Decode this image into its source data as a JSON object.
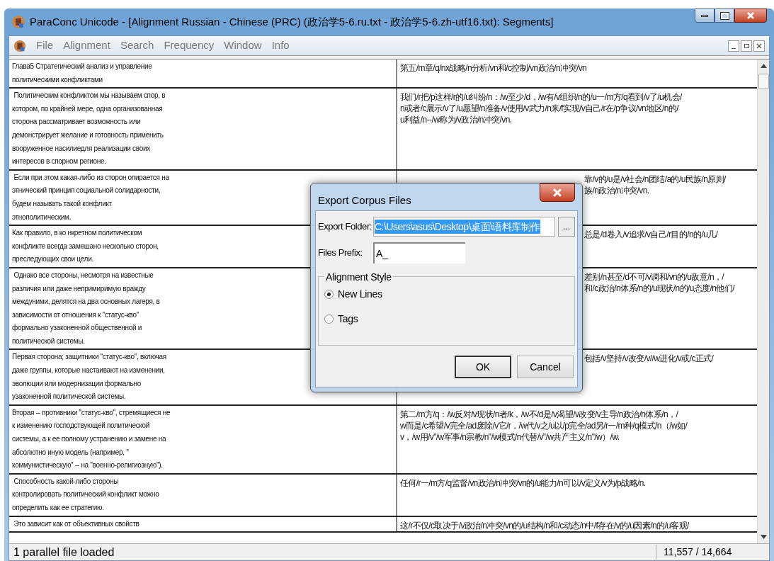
{
  "window": {
    "title": "ParaConc Unicode - [Alignment Russian - Chinese (PRC) (政治学5-6.ru.txt - 政治学5-6.zh-utf16.txt): Segments]"
  },
  "menu": [
    "File",
    "Alignment",
    "Search",
    "Frequency",
    "Window",
    "Info"
  ],
  "segments": [
    {
      "source": "Глава5 Стратегический анализ и управление\nполитическими конфликтами",
      "target": "第五/m章/q/nx战略/n分析/vn和/c控制/vn政治/n冲突/vn",
      "covered": false
    },
    {
      "source": " Политическим конфликтом мы называем спор, в\nкотором, по крайней мере, одна организованная\nсторона рассматривает возможность или\nдемонстрирует желание и готовность применить\nвооруженное насилиедля реализации своих\nинтересов в спорном регионе.",
      "target": "我们/r把/p这样/r的/u纠纷/n：/w至少/d，/w有/v组织/n的/u一/m方/q看到/v了/u机会/\nn或者/c展示/v了/u愿望/n准备/v使用/v武力/n来/f实现/v自己/r在/p争议/vn地区/n的/\nu利益/n--/w称为/v政治/n冲突/vn.",
      "covered": false
    },
    {
      "source": " Если при этом какая-либо из сторон опирается на\nэтнический принцип социальной солидарности,\nбудем называть такой конфликт\nэтнополитическим.",
      "target": "靠/v的/u是/v社会/n团结/a的/u民族/n原则/\n族/n政治/n冲突/vn.",
      "covered": true
    },
    {
      "source": "Как правило, в ко нкретном политическом\nконфликте всегда замешано несколько сторон,\nпреследующих свои цели.",
      "target": "总是/d卷入/v追求/v自己/r目的/n的/u几/",
      "covered": true
    },
    {
      "source": " Однако все стороны, несмотря на известные\nразличия или даже непримиримую вражду\nмеждуними, делятся на два основных лагеря, в\nзависимости от отношения к ''статус-кво''\nформально узаконенной общественной и\nполитической системы.",
      "target": "差别/n甚至/d不可/v调和/vn的/u敌意/n，/\n和/c政治/n体系/n的/u现状/n的/u态度/n他们/",
      "covered": true
    },
    {
      "source": "Первая сторона; защитники ''статус-кво'', включая\nдаже группы, которые настаивают на изменении,\nэволюции или модернизации формально\nузаконенной политической системы.",
      "target": "包括/v坚持/v改变/v//w进化/v或/c正式/",
      "covered": true
    },
    {
      "source": "Вторая -- противники ''статус-кво'', стремящиеся не\nк изменению господствующей политической\nсистемы, а к ее полному устранению и замене на\nабсолютно иную модель (например, ''\nкоммунистическую'' -- на ''военно-религиозную'').",
      "target": "第二/m方/q：/w反对/v现状/n者/k，/w不/d是/v渴望/v改变/v主导/n政治/n体系/n，/\nw而是/c希望/v完全/ad废除/v它/r，/w代/v之/u以/p完全/ad另/r一/m种/q模式/n（/w如/\nv，/w用/v\"/w军事/n宗教/n\"/w模式/n代替/v\"/w共产主义/n\"/w）/w.",
      "covered": false
    },
    {
      "source": " Способность какой-либо стороны\nконтролировать политический конфликт можно\nопределить как ее стратегию.",
      "target": "任何/r一/m方/q监督/vn政治/n冲突/vn的/u能力/n可以/v定义/v为/p战略/n.",
      "covered": false
    },
    {
      "source": " Это зависит как от объективных свойств",
      "target": "这/r不仅/c取决于/v政治/n冲突/vn的/u结构/n和/c动态/n中/f存在/v的/u因素/n的/u客观/",
      "covered": false
    }
  ],
  "status_bar": {
    "message": "1 parallel file loaded",
    "count": "11,557 / 14,664"
  },
  "dialog": {
    "title": "Export Corpus Files",
    "folder_label": "Export Folder:",
    "folder_value": "C:\\Users\\asus\\Desktop\\桌面\\语料库制作",
    "browse": "...",
    "prefix_label": "Files Prefix:",
    "prefix_value": "A_",
    "group_label": "Alignment Style",
    "options": [
      {
        "label": "New Lines",
        "selected": true
      },
      {
        "label": "Tags",
        "selected": false
      }
    ],
    "buttons": [
      "OK",
      "Cancel"
    ]
  }
}
